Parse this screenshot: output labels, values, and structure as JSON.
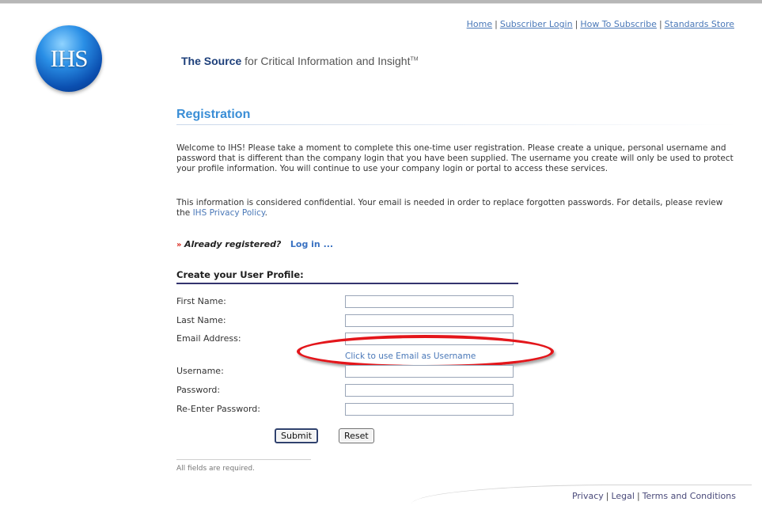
{
  "nav": {
    "home": "Home",
    "subscriber_login": "Subscriber Login",
    "how_to_subscribe": "How To Subscribe",
    "standards_store": "Standards Store",
    "separator": "|"
  },
  "brand": {
    "logo_text": "IHS",
    "tagline_bold": "The Source",
    "tagline_rest": " for Critical Information and Insight",
    "tagline_mark": "TM"
  },
  "registration": {
    "title": "Registration",
    "para1": "Welcome to IHS!  Please take a moment to complete this one-time user registration.  Please create a unique, personal username and password that is different than the company login that you have been supplied.  The username you create will only be used to protect your profile information.  You will continue to use your company login or portal to access these services.",
    "para2_text": "This information is considered confidential.  Your email is needed in order to replace forgotten passwords.  For details, please review the ",
    "para2_link": "IHS Privacy Policy",
    "para2_end": ".",
    "already_marker": "»",
    "already_text": "Already registered?",
    "login_link": "Log in ..."
  },
  "profile": {
    "title": "Create your User Profile:",
    "first_name_label": "First Name:",
    "first_name_value": "",
    "last_name_label": "Last Name:",
    "last_name_value": "",
    "email_label": "Email Address:",
    "email_value": "",
    "email_as_username_link": "Click to use Email as Username",
    "username_label": "Username:",
    "username_value": "",
    "password_label": "Password:",
    "password_value": "",
    "reenter_label": "Re-Enter Password:",
    "reenter_value": "",
    "submit_label": "Submit",
    "reset_label": "Reset",
    "required_note": "All fields are required."
  },
  "footer": {
    "privacy": "Privacy",
    "legal": "Legal",
    "terms": "Terms and Conditions",
    "separator": "|"
  },
  "colors": {
    "accent_blue": "#3a8ed6",
    "link_blue": "#4a78b8",
    "highlight_red": "#e3161b",
    "heading_rule": "#33336e"
  }
}
